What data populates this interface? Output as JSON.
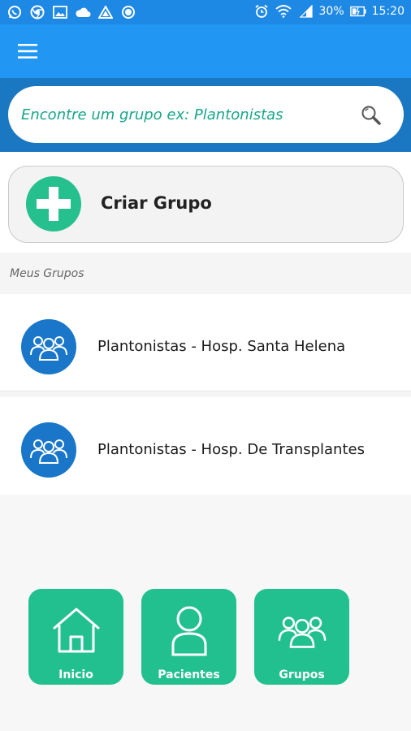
{
  "status_bar": {
    "battery": "30%",
    "time": "15:20",
    "left_icons": [
      "whatsapp-icon",
      "chrome-icon",
      "image-icon",
      "cloud-icon",
      "drive-icon",
      "circle-icon"
    ],
    "right_icons": [
      "alarm-icon",
      "wifi-icon",
      "signal-icon",
      "battery-icon"
    ]
  },
  "app_bar": {
    "menu_icon": "hamburger-menu-icon"
  },
  "search": {
    "placeholder": "Encontre um grupo ex: Plantonistas",
    "icon": "search-icon"
  },
  "create_group": {
    "label": "Criar Grupo",
    "icon": "plus-icon"
  },
  "my_groups": {
    "header": "Meus Grupos",
    "items": [
      {
        "name": "Plantonistas - Hosp. Santa Helena",
        "icon": "group-icon"
      },
      {
        "name": "Plantonistas - Hosp. De Transplantes",
        "icon": "group-icon"
      }
    ]
  },
  "bottom_nav": {
    "items": [
      {
        "label": "Inicio",
        "icon": "home-icon"
      },
      {
        "label": "Pacientes",
        "icon": "person-icon"
      },
      {
        "label": "Grupos",
        "icon": "group-icon"
      }
    ]
  },
  "colors": {
    "status_bar": "#1e88e5",
    "app_bar": "#2196f3",
    "search_band": "#1a78c2",
    "accent_green": "#22c08f",
    "group_avatar": "#1976c9",
    "placeholder_text": "#17a689"
  }
}
